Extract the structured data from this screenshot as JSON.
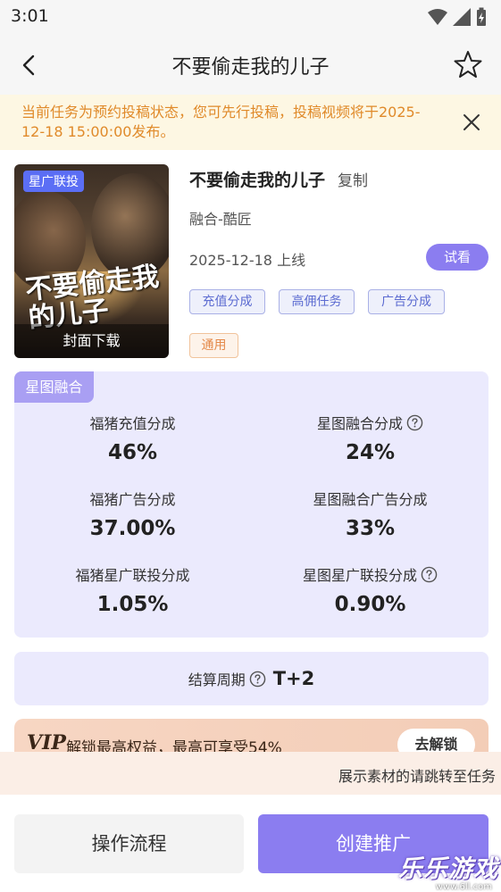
{
  "status_bar": {
    "time": "3:01"
  },
  "nav": {
    "title": "不要偷走我的儿子"
  },
  "notice": {
    "text": "当前任务为预约投稿状态，您可先行投稿，投稿视频将于2025-12-18 15:00:00发布。"
  },
  "poster": {
    "tag": "星广联投",
    "art_title": "不要偷走我的儿子",
    "download_label": "封面下载"
  },
  "info": {
    "title": "不要偷走我的儿子",
    "copy_label": "复制",
    "subtitle": "融合-酷匠",
    "date": "2025-12-18 上线",
    "trial_label": "试看",
    "tags": [
      "充值分成",
      "高佣任务",
      "广告分成"
    ],
    "tag_general": "通用"
  },
  "share": {
    "badge": "星图融合",
    "items": [
      {
        "label": "福猪充值分成",
        "value": "46%"
      },
      {
        "label": "星图融合分成",
        "value": "24%"
      },
      {
        "label": "福猪广告分成",
        "value": "37.00%"
      },
      {
        "label": "星图融合广告分成",
        "value": "33%"
      },
      {
        "label": "福猪星广联投分成",
        "value": "1.05%"
      },
      {
        "label": "星图星广联投分成",
        "value": "0.90%"
      }
    ]
  },
  "settle": {
    "label": "结算周期",
    "value": "T+2"
  },
  "vip": {
    "logo": "VIP",
    "text": "解锁最高权益，最高可享受54%",
    "button": "去解锁"
  },
  "marquee": {
    "text": "展示素材的请跳转至任务"
  },
  "bottom": {
    "process_label": "操作流程",
    "create_label": "创建推广"
  },
  "watermark": {
    "text": "乐乐游戏",
    "url": "www.6ll.com"
  },
  "colors": {
    "accent": "#8b7df0",
    "notice_text": "#e08a2a",
    "card_bg": "#ebeafd"
  }
}
